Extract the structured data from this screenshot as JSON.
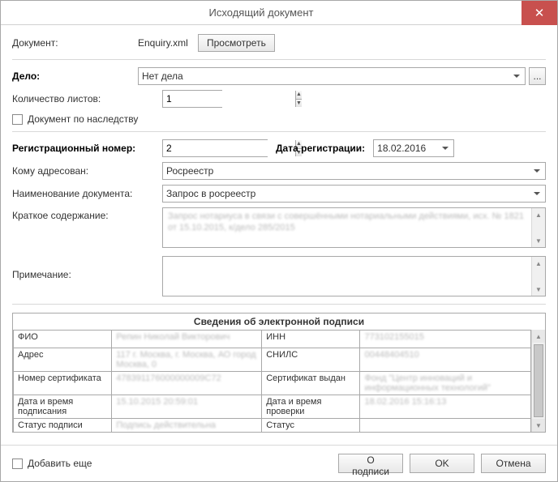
{
  "window": {
    "title": "Исходящий документ"
  },
  "top": {
    "document_label": "Документ:",
    "document_filename": "Enquiry.xml",
    "view_button": "Просмотреть"
  },
  "case": {
    "label": "Дело:",
    "value": "Нет дела",
    "more_button": "...",
    "sheets_label": "Количество листов:",
    "sheets_value": "1",
    "inheritance_label": "Документ по наследству"
  },
  "reg": {
    "regnum_label": "Регистрационный номер:",
    "regnum_value": "2",
    "regdate_label": "Дата регистрации:",
    "regdate_value": "18.02.2016",
    "addressee_label": "Кому адресован:",
    "addressee_value": "Росреестр",
    "docname_label": "Наименование документа:",
    "docname_value": "Запрос в росреестр",
    "summary_label": "Краткое содержание:",
    "summary_value": "Запрос нотариуса в связи с совершёнными нотариальными действиями, исх. № 1821 от 15.10.2015, к/дело 285/2015",
    "note_label": "Примечание:",
    "note_value": ""
  },
  "signature": {
    "legend": "Сведения об электронной подписи",
    "rows": [
      [
        "ФИО",
        "Репин Николай Викторович",
        "ИНН",
        "773102155015"
      ],
      [
        "Адрес",
        "117 г. Москва, г. Москва, АО город Москва, 0",
        "СНИЛС",
        "00448404510"
      ],
      [
        "Номер сертификата",
        "478391176000000009C72",
        "Сертификат выдан",
        "Фонд \"Центр инноваций и информационных технологий\""
      ],
      [
        "Дата и время подписания",
        "15.10.2015 20:59:01",
        "Дата и время проверки",
        "18.02.2016 15:16:13"
      ],
      [
        "Статус подписи",
        "Подпись действительна",
        "Статус",
        ""
      ]
    ]
  },
  "footer": {
    "add_more": "Добавить еще",
    "about_sig": "О подписи",
    "ok": "OK",
    "cancel": "Отмена"
  }
}
